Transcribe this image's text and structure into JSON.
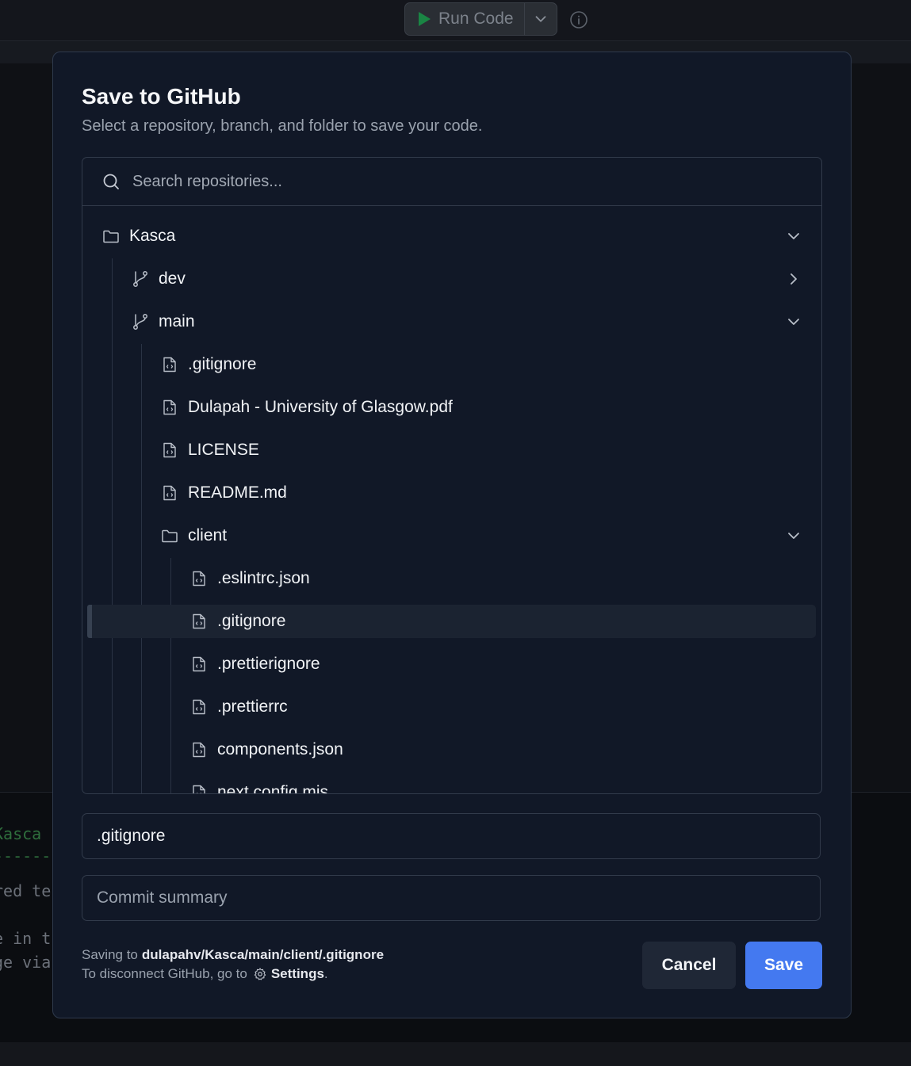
{
  "app": {
    "run_label": "Run Code",
    "terminal_lines": [
      "Kasca",
      "-------",
      "red te",
      "",
      "e in t",
      "ge via"
    ]
  },
  "modal": {
    "title": "Save to GitHub",
    "subtitle": "Select a repository, branch, and folder to save your code.",
    "search_placeholder": "Search repositories...",
    "tree": {
      "repo": "Kasca",
      "branch_dev": "dev",
      "branch_main": "main",
      "main_files": [
        ".gitignore",
        "Dulapah - University of Glasgow.pdf",
        "LICENSE",
        "README.md"
      ],
      "folder_client": "client",
      "client_files": [
        ".eslintrc.json",
        ".gitignore",
        ".prettierignore",
        ".prettierrc",
        "components.json",
        "next.config.mjs"
      ]
    },
    "filename_value": ".gitignore",
    "commit_placeholder": "Commit summary",
    "saving_prefix": "Saving to",
    "saving_path": "dulapahv/Kasca/main/client/.gitignore",
    "disconnect_prefix": "To disconnect GitHub, go to",
    "settings_label": "Settings",
    "period": ".",
    "cancel_label": "Cancel",
    "save_label": "Save"
  },
  "colors": {
    "accent": "#4479f0",
    "modal_bg": "#111827",
    "run_triangle": "#16a34a"
  }
}
